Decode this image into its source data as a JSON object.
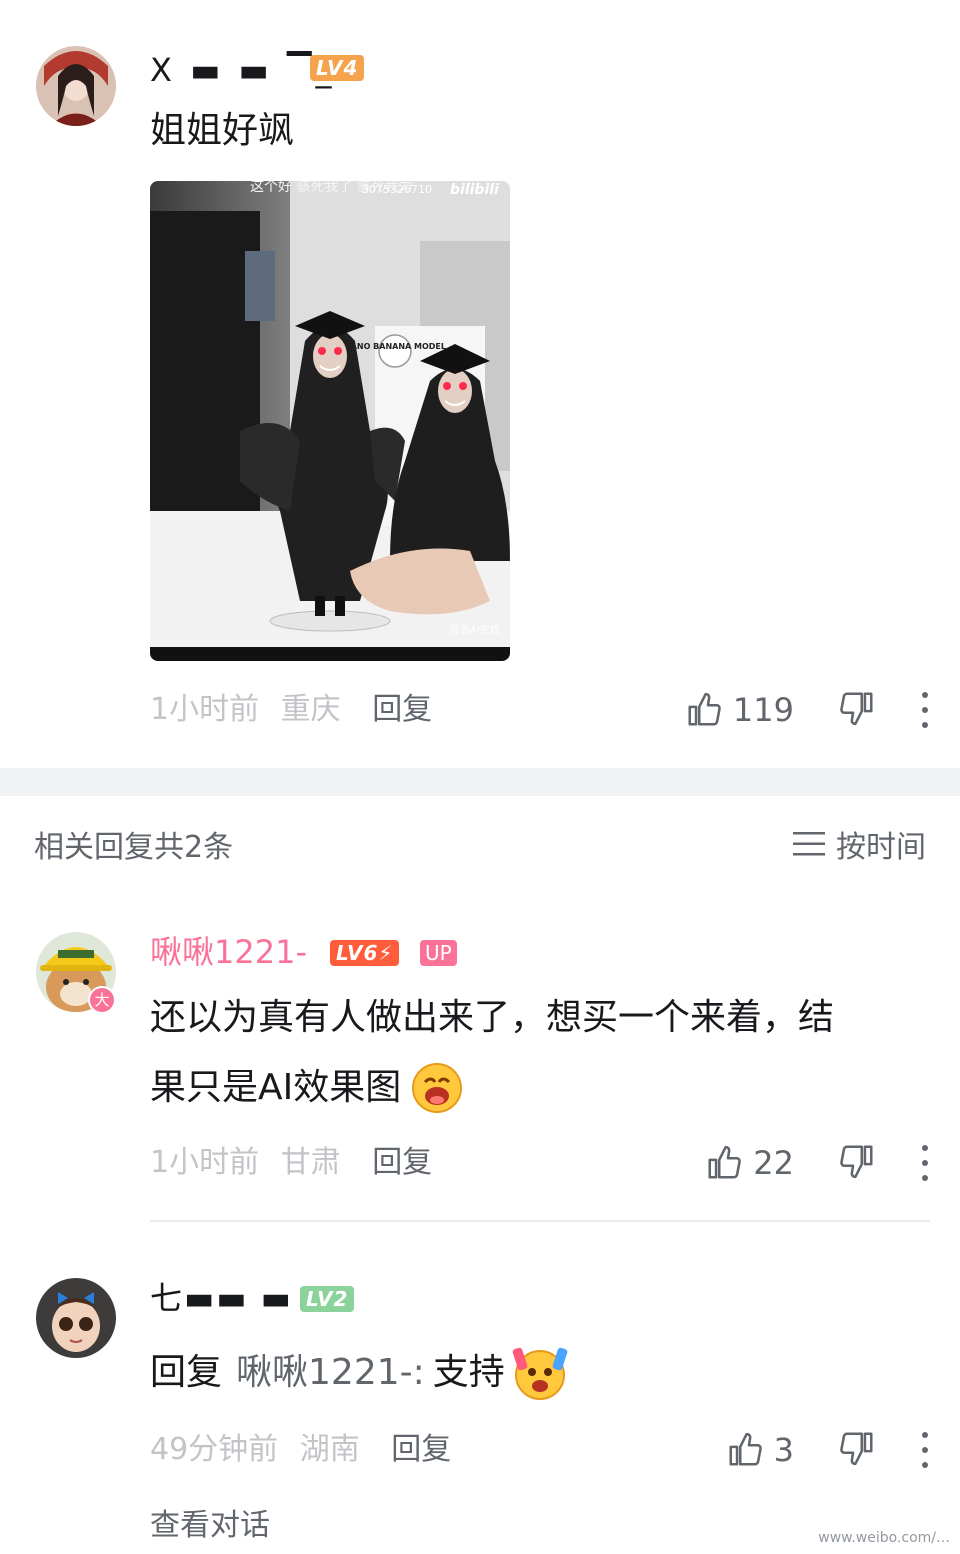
{
  "main_comment": {
    "username": "X ▬ ▬ ▔_",
    "level": "LV4",
    "text": "姐姐好飒",
    "image_overlay": {
      "top_text": "这个好\n骇死我了\n骇死我力",
      "uid_text": "3075326710",
      "logo": "bilibili",
      "box_label": "NANO BANANA MODEL",
      "corner_label": "豆包AI生成"
    },
    "time": "1小时前",
    "location": "重庆",
    "reply_label": "回复",
    "likes": "119"
  },
  "replies_header": {
    "count_label": "相关回复共2条",
    "sort_label": "按时间"
  },
  "reply1": {
    "username": "啾啾1221-",
    "level": "LV6⚡",
    "up_badge": "UP",
    "avatar_badge": "大",
    "text_line1": "还以为真有人做出来了，想买一个来着，结",
    "text_line2": "果只是AI效果图",
    "time": "1小时前",
    "location": "甘肃",
    "reply_label": "回复",
    "likes": "22"
  },
  "reply2": {
    "username": "七▬▬ ▬ ▬",
    "level": "LV2",
    "prefix": "回复",
    "mention": "啾啾1221-:",
    "text": "支持",
    "time": "49分钟前",
    "location": "湖南",
    "reply_label": "回复",
    "likes": "3",
    "view_conversation": "查看对话"
  },
  "watermark": "www.weibo.com/…",
  "colors": {
    "pink": "#fb7299",
    "lv4_orange": "#f5a34c",
    "lv6_red": "#ff5c3b",
    "lv2_green": "#8bd29b",
    "gray_text": "#61666d",
    "light_gray": "#c2c4c8"
  }
}
